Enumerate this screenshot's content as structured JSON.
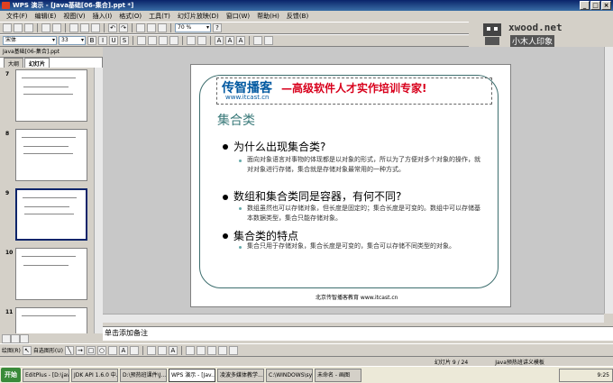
{
  "window": {
    "title": "WPS 演示 - [Java基础[06-集合].ppt *]"
  },
  "menu": [
    "文件(F)",
    "编辑(E)",
    "视图(V)",
    "插入(I)",
    "格式(O)",
    "工具(T)",
    "幻灯片放映(D)",
    "窗口(W)",
    "帮助(H)",
    "反馈(B)"
  ],
  "toolbar": {
    "font": "宋体",
    "size": "33",
    "zoom": "70 %"
  },
  "logo": {
    "brand": "xwood.net",
    "sub": "小木人印象"
  },
  "panel": {
    "file_tab": "Java基础[06-集合].ppt",
    "tabs": [
      "大纲",
      "幻灯片"
    ],
    "thumb_numbers": [
      "7",
      "8",
      "9",
      "10",
      "11"
    ]
  },
  "slide": {
    "brand": "传智播客",
    "brand_url": "www.itcast.cn",
    "slogan": "—高级软件人才实作培训专家!",
    "title": "集合类",
    "bullets": [
      {
        "text": "为什么出现集合类?",
        "sub": "面向对象语言对事物的体现都是以对象的形式，所以为了方便对多个对象的操作，就对对象进行存储，集合就是存储对象最常用的一种方式。"
      },
      {
        "text": "数组和集合类同是容器，有何不同?",
        "sub": "数组虽然也可以存储对象，但长度是固定的；集合长度是可变的。数组中可以存储基本数据类型，集合只能存储对象。"
      },
      {
        "text": "集合类的特点",
        "sub": "集合只用于存储对象，集合长度是可变的，集合可以存储不同类型的对象。"
      }
    ],
    "footer": "北京传智播客教育 www.itcast.cn"
  },
  "notes": {
    "placeholder": "单击添加备注"
  },
  "status": {
    "slide": "幻灯片 9 / 24",
    "template": "Java预热班讲义模板"
  },
  "drawbar": {
    "draw": "绘图(R)",
    "autoshape": "自选图形(U)"
  },
  "taskbar": {
    "start": "开始",
    "tasks": [
      "EditPlus - [D:\\jav...",
      "JDK API 1.6.0 中...",
      "D:\\预热班课件\\J...",
      "WPS 演示 - [Jav...",
      "凌波多媒体教学...",
      "C:\\WINDOWS\\sy...",
      "未命名 - 画图"
    ],
    "clock": "9:25"
  }
}
